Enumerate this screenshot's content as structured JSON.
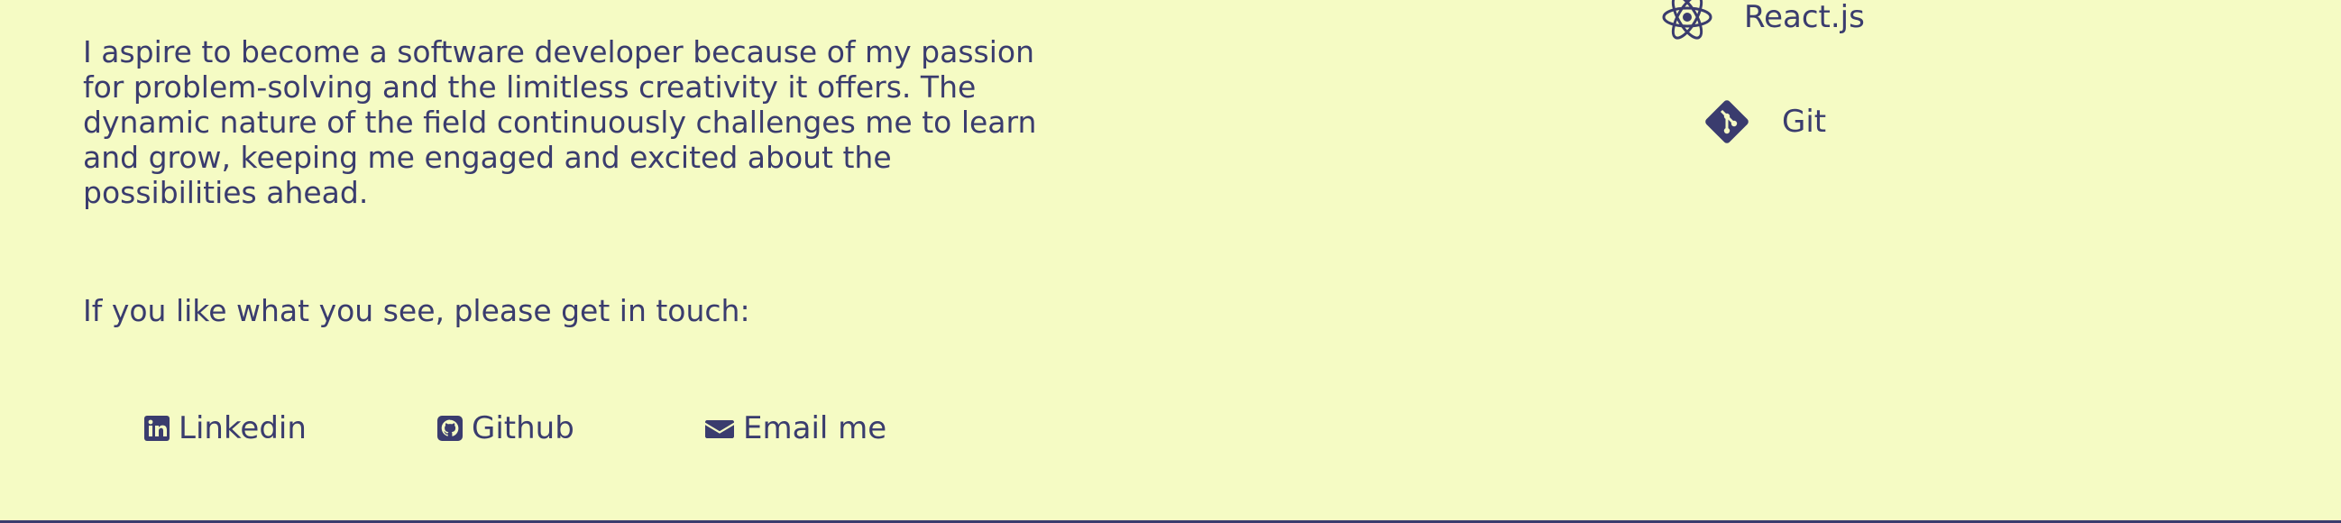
{
  "about": {
    "bio": "I aspire to become a software developer because of my passion for problem-solving and the limitless creativity it offers. The dynamic nature of the field continuously challenges me to learn and grow, keeping me engaged and excited about the possibilities ahead.",
    "cta": "If you like what you see, please get in touch:"
  },
  "contact": {
    "links": [
      {
        "label": "Linkedin",
        "icon": "linkedin-icon"
      },
      {
        "label": "Github",
        "icon": "github-icon"
      },
      {
        "label": "Email me",
        "icon": "envelope-icon"
      }
    ]
  },
  "skills": [
    {
      "label": "React.js",
      "icon": "react-icon"
    },
    {
      "label": "Git",
      "icon": "git-icon"
    }
  ],
  "colors": {
    "background": "#f5fbc4",
    "text": "#3a3c6e"
  }
}
